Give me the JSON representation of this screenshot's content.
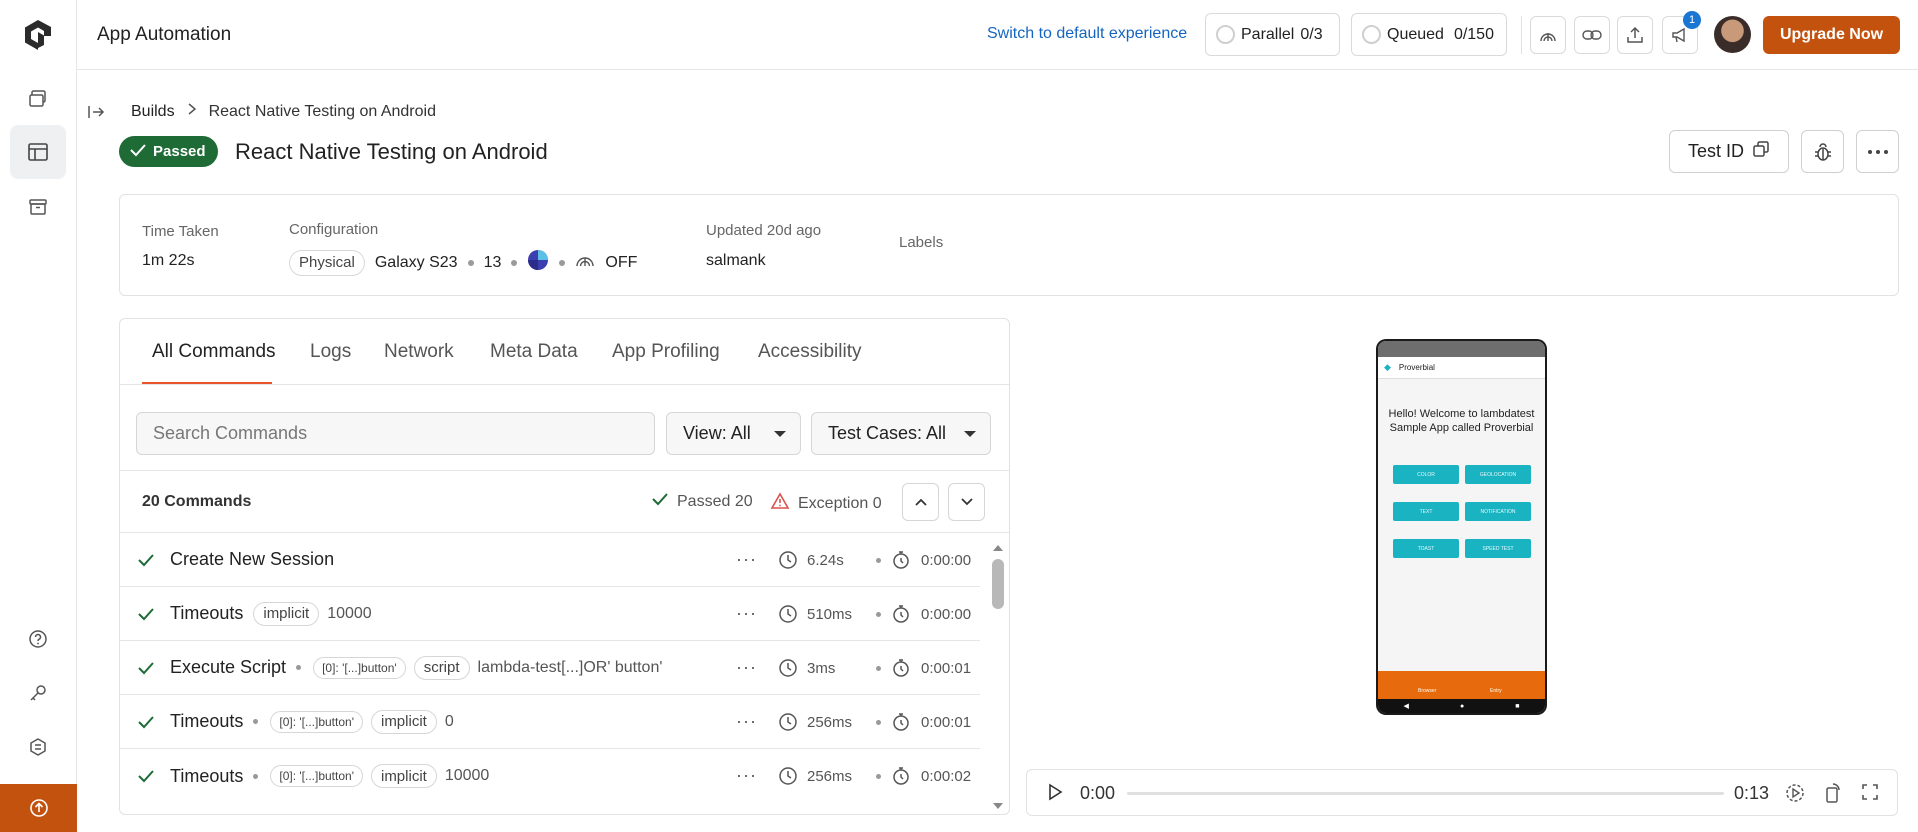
{
  "app": {
    "title": "App Automation"
  },
  "topbar": {
    "switch_label": "Switch to default experience",
    "parallel_label": "Parallel",
    "parallel_value": "0/3",
    "queued_label": "Queued",
    "queued_value": "0/150",
    "notification_count": "1",
    "upgrade_label": "Upgrade Now"
  },
  "breadcrumb": {
    "root": "Builds",
    "current": "React Native Testing on Android"
  },
  "header": {
    "status": "Passed",
    "title": "React Native Testing on Android",
    "test_id_label": "Test ID"
  },
  "info": {
    "time_taken_label": "Time Taken",
    "time_taken_value": "1m 22s",
    "configuration_label": "Configuration",
    "device_type": "Physical",
    "device_name": "Galaxy S23",
    "os_version": "13",
    "network_status": "OFF",
    "updated_label": "Updated 20d ago",
    "updated_by": "salmank",
    "labels_label": "Labels"
  },
  "tabs": [
    "All Commands",
    "Logs",
    "Network",
    "Meta Data",
    "App Profiling",
    "Accessibility"
  ],
  "filters": {
    "search_placeholder": "Search Commands",
    "view_label": "View: All",
    "testcases_label": "Test Cases: All"
  },
  "summary": {
    "count_label": "20 Commands",
    "passed_label": "Passed 20",
    "exception_label": "Exception 0"
  },
  "commands": [
    {
      "name": "Create New Session",
      "duration": "6.24s",
      "elapsed": "0:00:00"
    },
    {
      "name": "Timeouts",
      "tag": "implicit",
      "value": "10000",
      "duration": "510ms",
      "elapsed": "0:00:00"
    },
    {
      "name": "Execute Script",
      "tag1": "[0]: '[...]button'",
      "tag2": "script",
      "value": "lambda-test[...]OR' button'",
      "duration": "3ms",
      "elapsed": "0:00:01"
    },
    {
      "name": "Timeouts",
      "tag1": "[0]: '[...]button'",
      "tag2": "implicit",
      "value": "0",
      "duration": "256ms",
      "elapsed": "0:00:01"
    },
    {
      "name": "Timeouts",
      "tag1": "[0]: '[...]button'",
      "tag2": "implicit",
      "value": "10000",
      "duration": "256ms",
      "elapsed": "0:00:02"
    }
  ],
  "phone": {
    "app_title": "Proverbial",
    "welcome": "Hello! Welcome to lambdatest Sample App called Proverbial",
    "buttons": [
      "COLOR",
      "GEOLOCATION",
      "TEXT",
      "NOTIFICATION",
      "TOAST",
      "SPEED TEST"
    ],
    "footer_items": [
      "Browser",
      "Entry"
    ]
  },
  "player": {
    "current": "0:00",
    "total": "0:13"
  },
  "colors": {
    "accent": "#c4520f",
    "passed": "#1e6b36",
    "link": "#1565c0",
    "tab_underline": "#e8552a"
  }
}
